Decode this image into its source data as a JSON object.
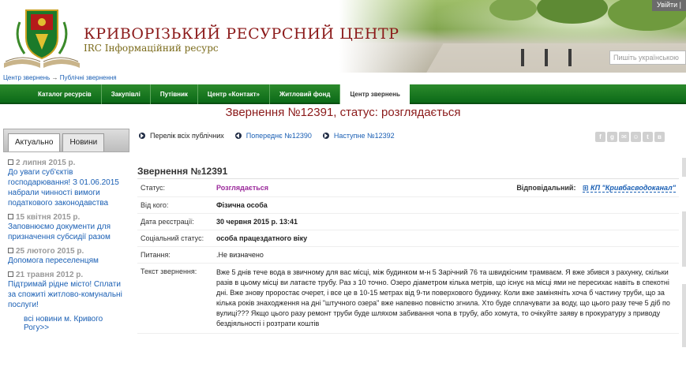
{
  "header": {
    "site_title": "КРИВОРІЗЬКИЙ РЕСУРСНИЙ ЦЕНТР",
    "site_subtitle": "IRC Інформаційний ресурс",
    "login_label": "Увійти",
    "search_placeholder": "Пишіть українською"
  },
  "breadcrumb": {
    "items": [
      "Центр звернень",
      "Публічні звернення"
    ],
    "separator": "→"
  },
  "nav": {
    "items": [
      "Каталог ресурсів",
      "Закупівлі",
      "Путівник",
      "Центр «Контакт»",
      "Житловий фонд",
      "Центр звернень"
    ],
    "active_index": 5
  },
  "page_title": "Звернення №12391, статус: розглядається",
  "sidebar": {
    "tabs": [
      "Актуально",
      "Новини"
    ],
    "news": [
      {
        "date": "2 липня 2015 р.",
        "text": "До уваги суб'єктів господарювання! З 01.06.2015 набрали чинності вимоги податкового законодавства"
      },
      {
        "date": "15 квітня 2015 р.",
        "text": "Заповнюємо документи для призначення субсидії разом"
      },
      {
        "date": "25 лютого 2015 р.",
        "text": "Допомога переселенцям"
      },
      {
        "date": "21 травня 2012 р.",
        "text": "Підтримай рідне місто! Сплати за спожиті житлово-комунальні послуги!"
      }
    ],
    "all_news": "всі новини м. Кривого Рогу>>"
  },
  "pager": {
    "list_label": "Перелік всіх публічних",
    "prev_label": "Попереднє №12390",
    "next_label": "Наступне №12392"
  },
  "share_icons": [
    "f",
    "g",
    "✉",
    "☺",
    "t",
    "в"
  ],
  "appeal": {
    "title": "Звернення №12391",
    "status_label": "Статус:",
    "status_value": "Розглядається",
    "responsible_label": "Відповідальний:",
    "responsible_value": "КП \"Кривбасводоканал\"",
    "from_label": "Від кого:",
    "from_value": "Фізична особа",
    "date_label": "Дата реєстрації:",
    "date_value": "30 червня 2015 р. 13:41",
    "social_label": "Соціальний статус:",
    "social_value": "особа працездатного віку",
    "question_label": "Питання:",
    "question_value": ".Не визначено",
    "text_label": "Текст звернення:",
    "text_value": "Вже 5 днів тече вода в звичному для вас місці, між будинком м-н 5 Зарічний 76 та швидкісним трамваєм. Я вже збився з рахунку, скільки разів в цьому місці ви латаєте трубу. Раз з 10 точно. Озеро діаметром кілька метрів, що існує на місці ями не пересихає навіть в спекотні дні. Вже знову проростає очерет, і все це в 10-15 метрах від 9-ти поверхового будинку. Коли вже заміняніть хоча б частину труби, що за кілька років знаходження на дні \"штучного озера\" вже напевно повністю згнила. Хто буде сплачувати за воду, що цього разу тече 5 діб по вулиці??? Якщо цього разу ремонт труби буде шляхом забивання чопа в трубу, або хомута, то очікуйте заяву в прокуратуру з приводу бездіяльності і розтрати коштів"
  },
  "colors": {
    "nav_green": "#0c6a18",
    "title_red": "#8b1a1a",
    "status_purple": "#9b2a9b",
    "link_blue": "#1a5fb4"
  }
}
